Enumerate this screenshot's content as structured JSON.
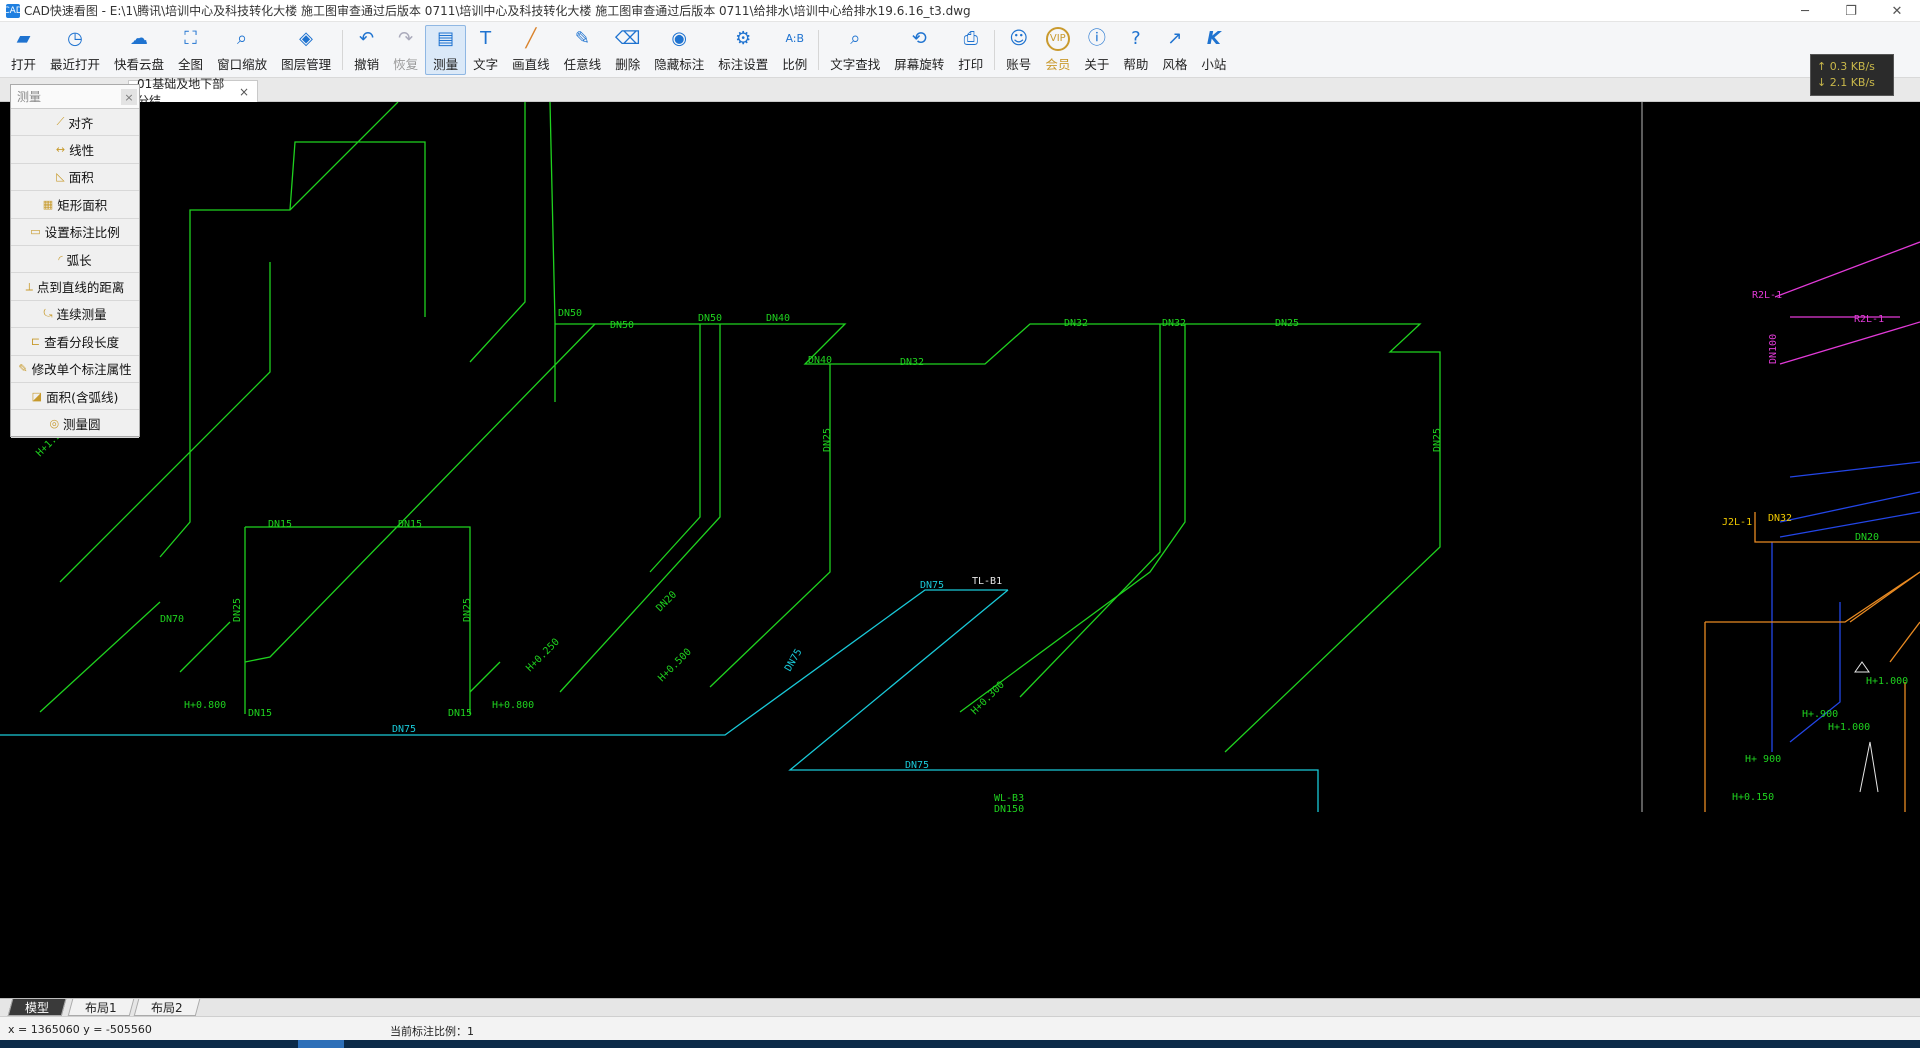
{
  "window": {
    "app_icon": "CAD",
    "title": "CAD快速看图 - E:\\1\\腾讯\\培训中心及科技转化大楼 施工图审查通过后版本 0711\\培训中心及科技转化大楼 施工图审查通过后版本 0711\\给排水\\培训中心给排水19.6.16_t3.dwg"
  },
  "toolbar": {
    "buttons": [
      {
        "label": "打开",
        "icon": "folder-icon"
      },
      {
        "label": "最近打开",
        "icon": "clock-icon"
      },
      {
        "label": "快看云盘",
        "icon": "cloud-icon"
      },
      {
        "label": "全图",
        "icon": "fullview-icon"
      },
      {
        "label": "窗口缩放",
        "icon": "zoom-window-icon"
      },
      {
        "label": "图层管理",
        "icon": "layers-icon"
      },
      {
        "label": "撤销",
        "icon": "undo-icon"
      },
      {
        "label": "恢复",
        "icon": "redo-icon"
      },
      {
        "label": "测量",
        "icon": "measure-icon"
      },
      {
        "label": "文字",
        "icon": "text-icon"
      },
      {
        "label": "画直线",
        "icon": "line-icon"
      },
      {
        "label": "任意线",
        "icon": "pen-icon"
      },
      {
        "label": "删除",
        "icon": "eraser-icon"
      },
      {
        "label": "隐藏标注",
        "icon": "eye-icon"
      },
      {
        "label": "标注设置",
        "icon": "annotation-settings-icon"
      },
      {
        "label": "比例",
        "icon": "scale-icon"
      },
      {
        "label": "文字查找",
        "icon": "text-search-icon"
      },
      {
        "label": "屏幕旋转",
        "icon": "rotate-icon"
      },
      {
        "label": "打印",
        "icon": "print-icon"
      },
      {
        "label": "账号",
        "icon": "user-icon"
      },
      {
        "label": "会员",
        "icon": "vip-icon"
      },
      {
        "label": "关于",
        "icon": "info-icon"
      },
      {
        "label": "帮助",
        "icon": "help-icon"
      },
      {
        "label": "风格",
        "icon": "style-icon"
      },
      {
        "label": "小站",
        "icon": "k-logo-icon"
      }
    ],
    "net_speed": {
      "up": "↑ 0.3 KB/s",
      "down": "↓ 2.1 KB/s"
    }
  },
  "tabs": {
    "doc_tab": "01基础及地下部分结…",
    "close": "×"
  },
  "measure_panel": {
    "title": "测量",
    "close": "×",
    "items": [
      "对齐",
      "线性",
      "面积",
      "矩形面积",
      "设置标注比例",
      "弧长",
      "点到直线的距离",
      "连续测量",
      "查看分段长度",
      "修改单个标注属性",
      "面积(含弧线)",
      "测量圆"
    ]
  },
  "drawing": {
    "labels": [
      "DN50",
      "DN50",
      "DN50",
      "DN40",
      "DN40",
      "DN32",
      "DN32",
      "DN32",
      "DN25",
      "DN25",
      "DN25",
      "DN25",
      "DN25",
      "DN15",
      "DN15",
      "DN15",
      "DN15",
      "DN20",
      "DN70",
      "DN75",
      "DN75",
      "DN75",
      "DN75",
      "H+0.800",
      "H+0.800",
      "H+0.250",
      "H+0.500",
      "H+0.300",
      "H+1.300",
      "TL-B1",
      "WL-B3",
      "DN150",
      "R2L-1",
      "R2L-1",
      "J2L-1",
      "DN100",
      "H+1.000",
      "H+.900",
      "H+1.000",
      "H+ 900",
      "H+0.150",
      "DN32",
      "DN20"
    ]
  },
  "layout_tabs": [
    "模型",
    "布局1",
    "布局2"
  ],
  "status": {
    "coords": "x = 1365060  y = -505560",
    "scale": "当前标注比例：1"
  }
}
